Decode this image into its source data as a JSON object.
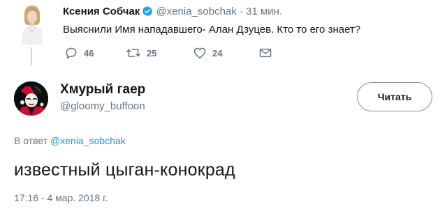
{
  "parent_tweet": {
    "author_name": "Ксения Собчак",
    "author_handle": "@xenia_sobchak",
    "separator": "·",
    "time_ago": "31 мин.",
    "text": "Выяснили Имя нападавшего- Алан Дзуцев. Кто то его знает?",
    "actions": {
      "replies": "46",
      "retweets": "25",
      "likes": "24"
    },
    "icons": [
      "verified-badge-icon",
      "reply-icon",
      "retweet-icon",
      "like-icon",
      "message-icon"
    ]
  },
  "reply_tweet": {
    "author_name": "Хмурый гаер",
    "author_handle": "@gloomy_buffoon",
    "follow_label": "Читать",
    "reply_to_prefix": "В ответ",
    "reply_to_handle": "@xenia_sobchak",
    "text": "известный цыган-конокрад",
    "timestamp": "17:16 - 4 мар. 2018 г."
  },
  "colors": {
    "text": "#14171a",
    "secondary": "#657786",
    "link": "#1b95e0",
    "verified": "#1da1f2",
    "thread_line": "#ccd6dd"
  }
}
